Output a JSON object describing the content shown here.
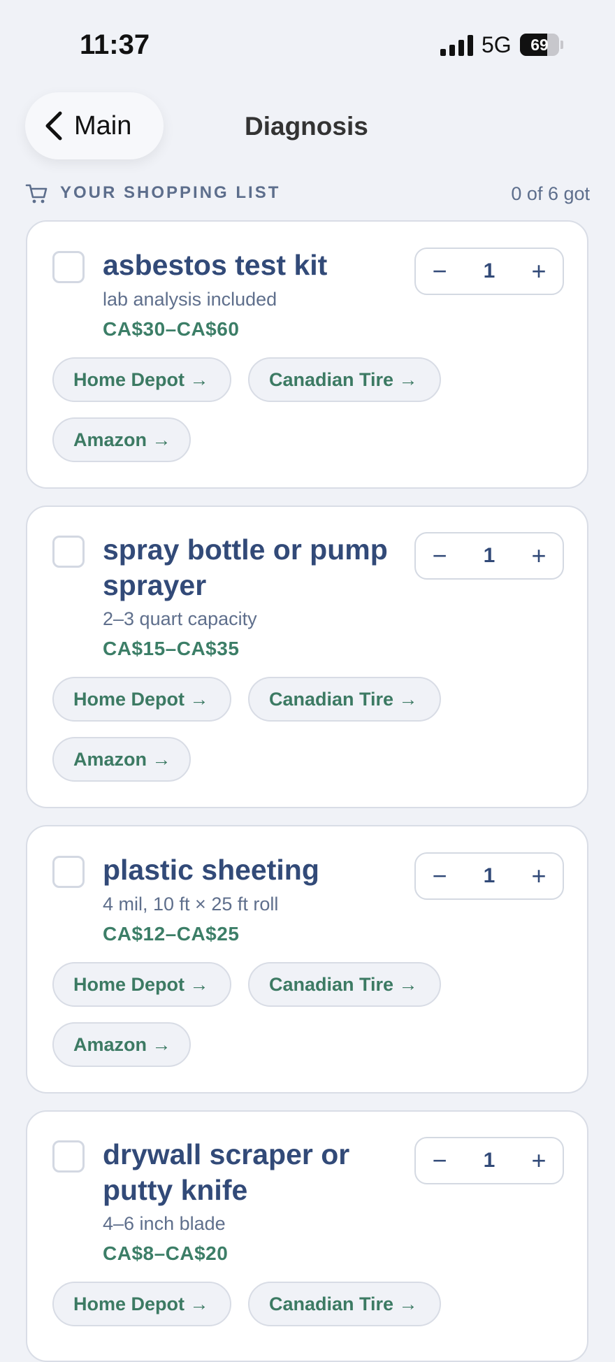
{
  "status_bar": {
    "time": "11:37",
    "network": "5G",
    "battery": "69",
    "battery_level": 0.69
  },
  "nav": {
    "back_label": "Main",
    "title": "Diagnosis"
  },
  "list": {
    "label": "YOUR SHOPPING LIST",
    "count": "0 of 6 got"
  },
  "colors": {
    "background": "#f0f2f7",
    "title": "#324a78",
    "price": "#3c7e67",
    "store_link": "#3c7a63"
  },
  "items": [
    {
      "name": "asbestos test kit",
      "note": "lab analysis included",
      "price": "CA$30–CA$60",
      "quantity": "1",
      "stores": [
        "Home Depot →",
        "Canadian Tire →",
        "Amazon →"
      ]
    },
    {
      "name": "spray bottle or pump sprayer",
      "note": "2–3 quart capacity",
      "price": "CA$15–CA$35",
      "quantity": "1",
      "stores": [
        "Home Depot →",
        "Canadian Tire →",
        "Amazon →"
      ]
    },
    {
      "name": "plastic sheeting",
      "note": "4 mil, 10 ft × 25 ft roll",
      "price": "CA$12–CA$25",
      "quantity": "1",
      "stores": [
        "Home Depot →",
        "Canadian Tire →",
        "Amazon →"
      ]
    },
    {
      "name": "drywall scraper or putty knife",
      "note": "4–6 inch blade",
      "price": "CA$8–CA$20",
      "quantity": "1",
      "stores": [
        "Home Depot →",
        "Canadian Tire →"
      ]
    }
  ]
}
